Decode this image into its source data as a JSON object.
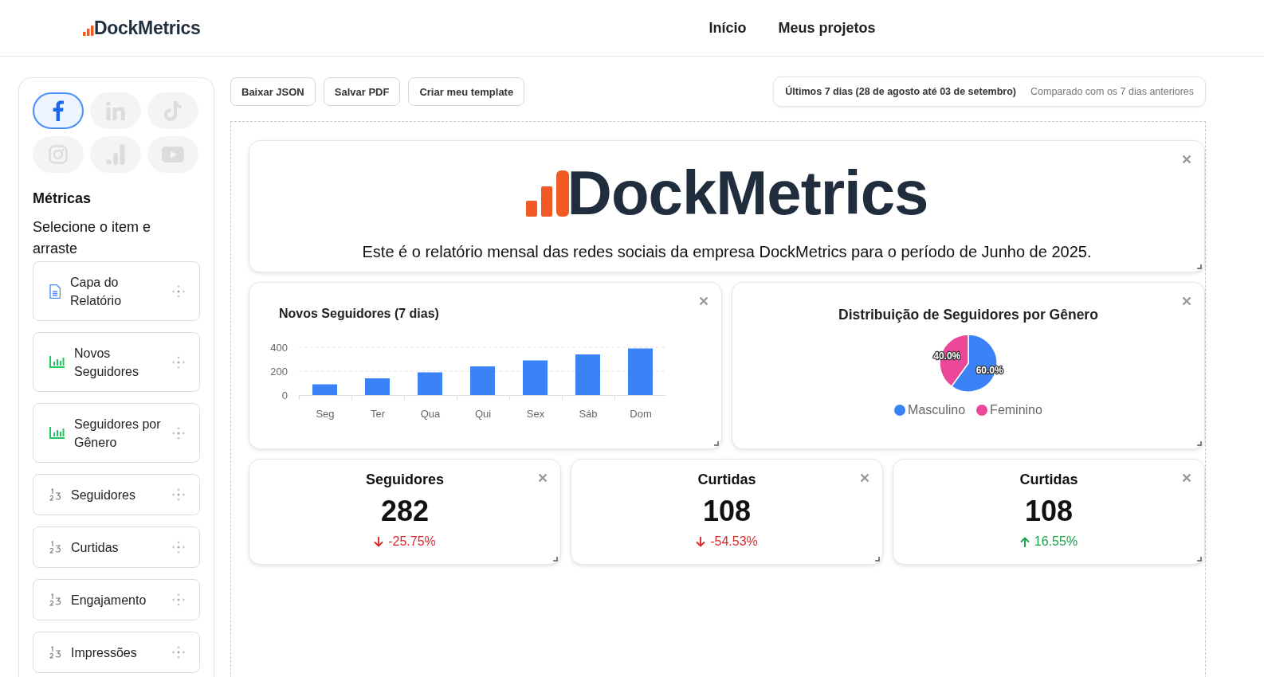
{
  "header": {
    "logo": "DockMetrics",
    "nav": [
      {
        "label": "Início"
      },
      {
        "label": "Meus projetos"
      }
    ]
  },
  "sidebar": {
    "networks": [
      {
        "kind": "facebook",
        "selected": true
      },
      {
        "kind": "linkedin",
        "selected": false
      },
      {
        "kind": "tiktok",
        "selected": false
      },
      {
        "kind": "instagram",
        "selected": false
      },
      {
        "kind": "analytics",
        "selected": false
      },
      {
        "kind": "youtube",
        "selected": false
      }
    ],
    "title": "Métricas",
    "hint": "Selecione o item e arraste",
    "items": [
      {
        "kind": "document",
        "label": "Capa do Relatório"
      },
      {
        "kind": "chart",
        "label": "Novos Seguidores"
      },
      {
        "kind": "chart",
        "label": "Seguidores por Gênero"
      },
      {
        "kind": "number",
        "label": "Seguidores"
      },
      {
        "kind": "number",
        "label": "Curtidas"
      },
      {
        "kind": "number",
        "label": "Engajamento"
      },
      {
        "kind": "number",
        "label": "Impressões"
      }
    ]
  },
  "toolbar": {
    "buttons": [
      "Baixar JSON",
      "Salvar PDF",
      "Criar meu template"
    ],
    "period": "Últimos 7 dias (28 de agosto até 03 de setembro)",
    "comparison": "Comparado com os 7 dias anteriores"
  },
  "cover": {
    "logo": "DockMetrics",
    "text": "Este é o relatório mensal das redes sociais da empresa DockMetrics para o período de Junho de 2025."
  },
  "bar_card": {
    "chart_data": {
      "type": "bar",
      "title": "Novos Seguidores (7 dias)",
      "categories": [
        "Seg",
        "Ter",
        "Qua",
        "Qui",
        "Sex",
        "Sáb",
        "Dom"
      ],
      "values": [
        90,
        140,
        190,
        240,
        290,
        340,
        390
      ],
      "ylim": [
        0,
        400
      ],
      "yticks": [
        0,
        200,
        400
      ]
    }
  },
  "pie_card": {
    "chart_data": {
      "type": "pie",
      "title": "Distribuição de Seguidores por Gênero",
      "categories": [
        "Masculino",
        "Feminino"
      ],
      "values": [
        60,
        40
      ],
      "value_labels": [
        "60.0%",
        "40.0%"
      ]
    },
    "legend": [
      {
        "color": "#3b82f6"
      },
      {
        "color": "#ec4899"
      }
    ]
  },
  "metrics": [
    {
      "title": "Seguidores",
      "value": "282",
      "change": "-25.75%",
      "increase": false
    },
    {
      "title": "Curtidas",
      "value": "108",
      "change": "-54.53%",
      "increase": false
    },
    {
      "title": "Curtidas",
      "value": "108",
      "change": "16.55%",
      "increase": true
    }
  ]
}
